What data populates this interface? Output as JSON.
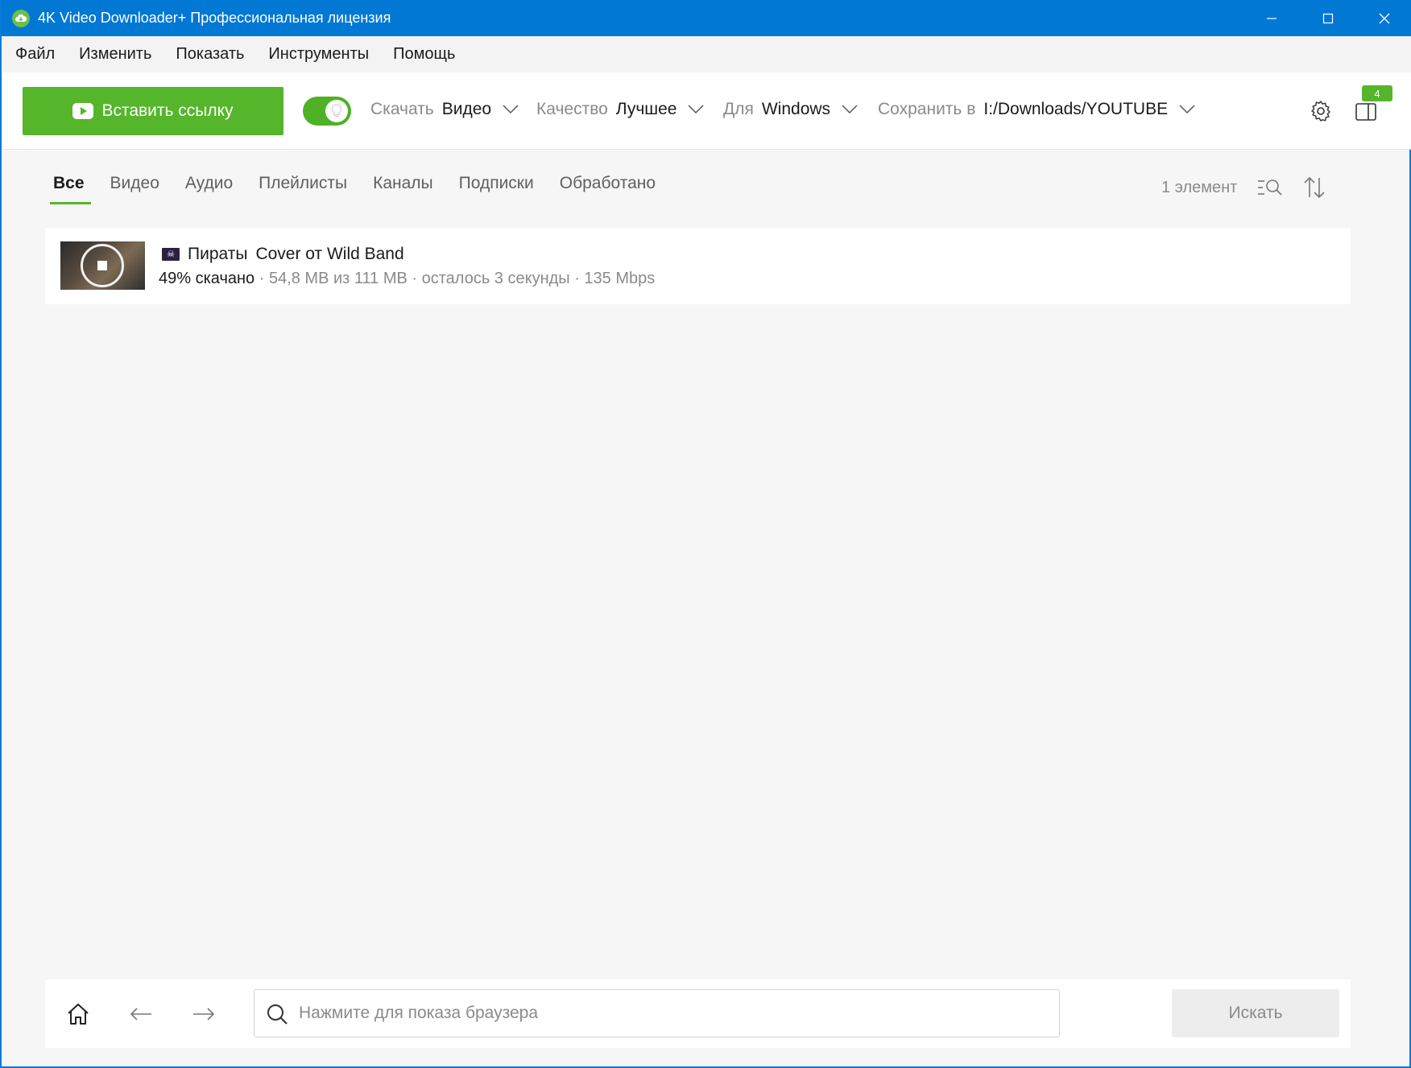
{
  "window": {
    "title": "4K Video Downloader+ Профессиональная лицензия"
  },
  "menu": [
    "Файл",
    "Изменить",
    "Показать",
    "Инструменты",
    "Помощь"
  ],
  "toolbar": {
    "paste_label": "Вставить ссылку",
    "smart_mode_enabled": true,
    "download": {
      "label": "Скачать",
      "value": "Видео"
    },
    "quality": {
      "label": "Качество",
      "value": "Лучшее"
    },
    "for": {
      "label": "Для",
      "value": "Windows"
    },
    "save_to": {
      "label": "Сохранить в",
      "value": "I:/Downloads/YOUTUBE"
    },
    "badge_count": "4"
  },
  "tabs": [
    {
      "label": "Все",
      "active": true
    },
    {
      "label": "Видео",
      "active": false
    },
    {
      "label": "Аудио",
      "active": false
    },
    {
      "label": "Плейлисты",
      "active": false
    },
    {
      "label": "Каналы",
      "active": false
    },
    {
      "label": "Подписки",
      "active": false
    },
    {
      "label": "Обработано",
      "active": false
    }
  ],
  "item_count": "1 элемент",
  "downloads": [
    {
      "title": "Пираты",
      "subtitle": "Cover от Wild Band",
      "progress_text": "49% скачано",
      "progress": 0.49,
      "details": " · 54,8 MB из 111 MB · осталось 3 секунды · 135 Mbps"
    }
  ],
  "browser": {
    "search_placeholder": "Нажмите для показа браузера",
    "search_value": "",
    "search_button": "Искать"
  },
  "colors": {
    "titlebar": "#0078d4",
    "accent": "#55b52b"
  }
}
